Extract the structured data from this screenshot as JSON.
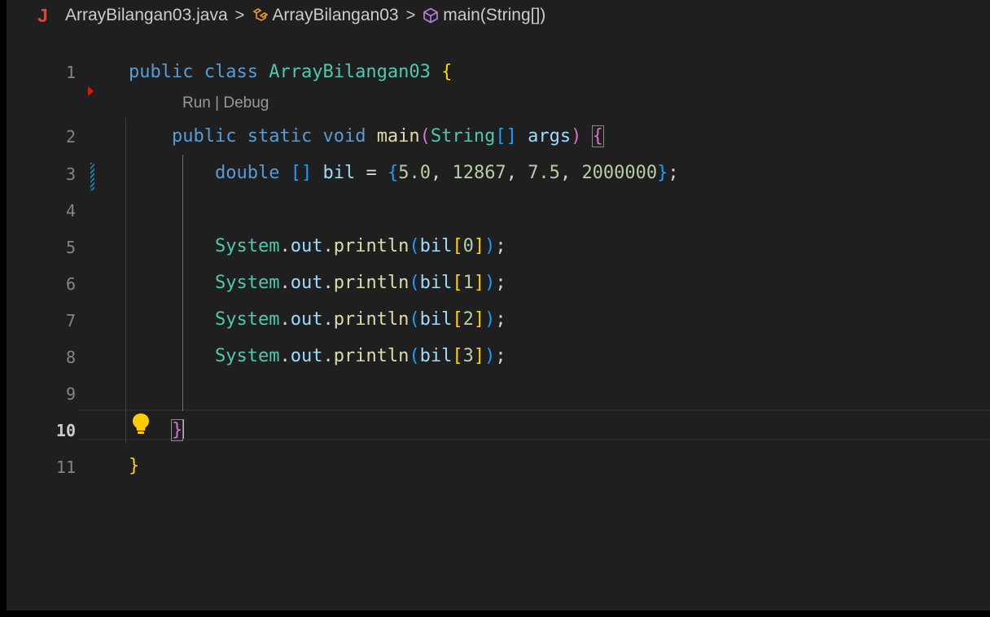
{
  "breadcrumb": {
    "file_icon": "J",
    "file": "ArrayBilangan03.java",
    "separator": ">",
    "class_name": "ArrayBilangan03",
    "method": "main(String[])",
    "icons": [
      "java-file-icon",
      "class-icon",
      "method-cube-icon"
    ]
  },
  "codelens": {
    "run": "Run",
    "separator": "|",
    "debug": "Debug"
  },
  "line_numbers": [
    "1",
    "2",
    "3",
    "4",
    "5",
    "6",
    "7",
    "8",
    "9",
    "10",
    "11"
  ],
  "active_line": "10",
  "code": {
    "kw_public": "public",
    "kw_class": "class",
    "class_name": "ArrayBilangan03",
    "kw_static": "static",
    "kw_void": "void",
    "fn_main": "main",
    "type_string": "String",
    "param_args": "args",
    "kw_double": "double",
    "var_bil": "bil",
    "values": [
      "5.0",
      "12867",
      "7.5",
      "2000000"
    ],
    "system": "System",
    "out": "out",
    "println": "println",
    "indices": [
      "0",
      "1",
      "2",
      "3"
    ]
  },
  "colors": {
    "background": "#1f1f1f",
    "keyword": "#569cd6",
    "class": "#4ec9b0",
    "function": "#dcdcaa",
    "variable": "#9cdcfe",
    "number": "#b5cea8",
    "bracket_level1": "#ffd700",
    "bracket_level2": "#da70d6",
    "bracket_level3": "#179fff",
    "java_icon": "#e0443b",
    "breakpoint": "#e51400",
    "lightbulb": "#ffcc00"
  }
}
